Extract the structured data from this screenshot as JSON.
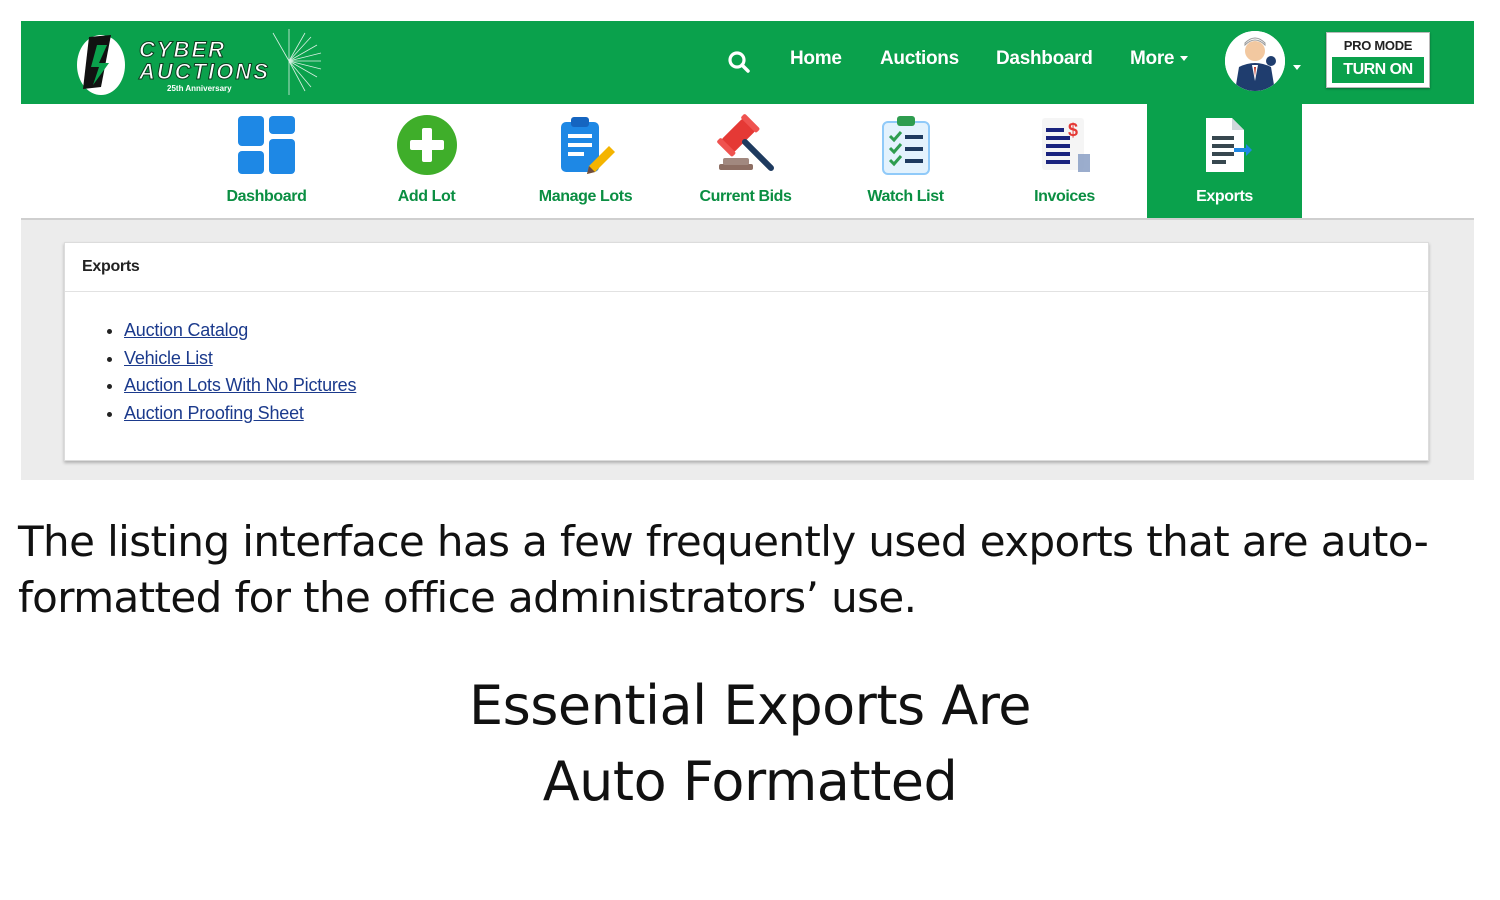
{
  "brand": {
    "line1": "CYBER",
    "line2": "AUCTIONS",
    "tagline": "25th Anniversary"
  },
  "nav": {
    "links": [
      "Home",
      "Auctions",
      "Dashboard",
      "More"
    ],
    "search_icon": "search-icon"
  },
  "pro_mode": {
    "label": "PRO MODE",
    "button": "TURN ON"
  },
  "toolbar": {
    "items": [
      {
        "label": "Dashboard",
        "icon": "dashboard-grid-icon"
      },
      {
        "label": "Add Lot",
        "icon": "plus-circle-icon"
      },
      {
        "label": "Manage Lots",
        "icon": "clipboard-pencil-icon"
      },
      {
        "label": "Current Bids",
        "icon": "gavel-icon"
      },
      {
        "label": "Watch List",
        "icon": "checklist-icon"
      },
      {
        "label": "Invoices",
        "icon": "invoice-dollar-icon"
      },
      {
        "label": "Exports",
        "icon": "document-export-icon",
        "active": true
      }
    ]
  },
  "exports_card": {
    "title": "Exports",
    "links": [
      "Auction Catalog",
      "Vehicle List",
      "Auction Lots With No Pictures",
      "Auction Proofing Sheet"
    ]
  },
  "caption": "The listing interface has a few frequently used exports that are auto-formatted for the office administrators’ use.",
  "headline": {
    "line1": "Essential Exports Are",
    "line2": "Auto Formatted"
  },
  "colors": {
    "brand_green": "#0aa14c",
    "link_blue": "#1b3a8c",
    "toolbar_label_green": "#0a8e42"
  }
}
